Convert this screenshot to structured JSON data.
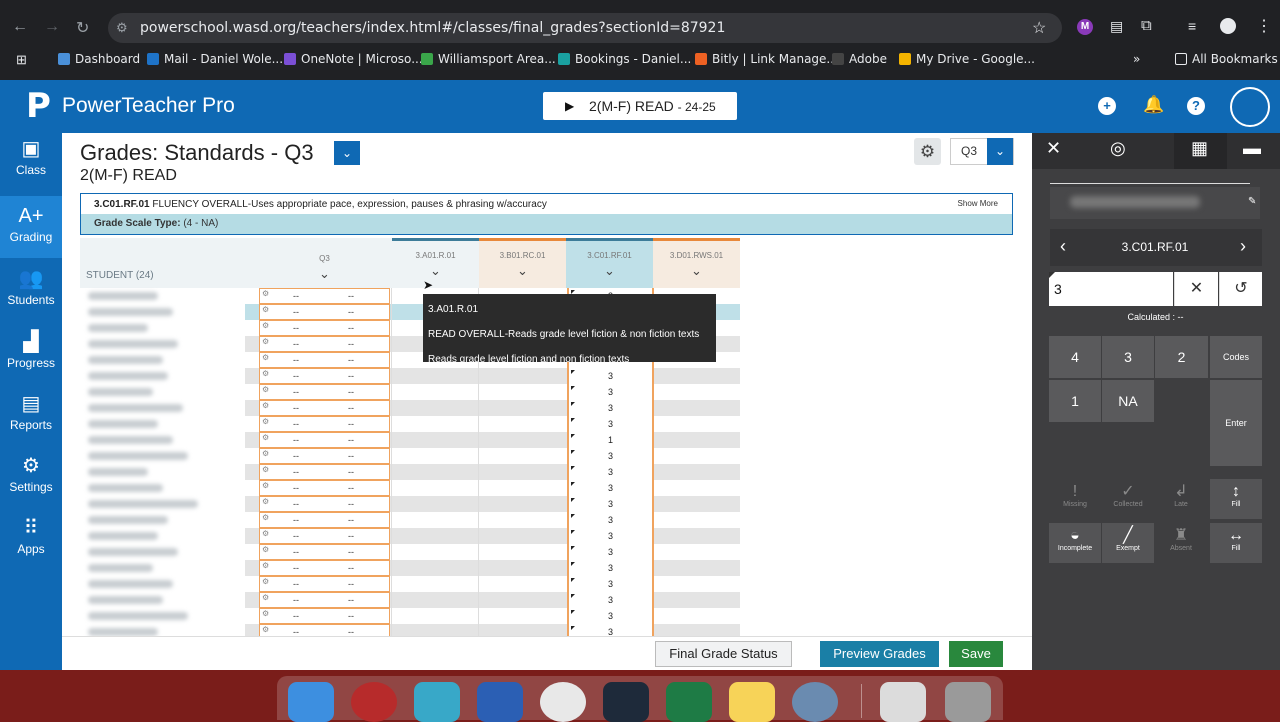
{
  "browser": {
    "url": "powerschool.wasd.org/teachers/index.html#/classes/final_grades?sectionId=87921",
    "bookmarks": [
      {
        "label": "Dashboard",
        "color": "#4a90d9"
      },
      {
        "label": "Mail - Daniel Wole...",
        "color": "#1e73c8"
      },
      {
        "label": "OneNote | Microso...",
        "color": "#7b4fd6"
      },
      {
        "label": "Williamsport Area...",
        "color": "#3aa64a"
      },
      {
        "label": "Bookings - Daniel...",
        "color": "#1aa1a1"
      },
      {
        "label": "Bitly | Link Manage...",
        "color": "#ee6123"
      },
      {
        "label": "Adobe",
        "color": "#111111"
      },
      {
        "label": "My Drive - Google...",
        "color": "#f4b400"
      }
    ],
    "all_bookmarks": "All Bookmarks",
    "profile_letter": "M"
  },
  "app": {
    "title": "PowerTeacher Pro",
    "class_selector": "2(M-F) READ",
    "class_year": "- 24-25"
  },
  "nav": [
    {
      "label": "Class",
      "icon": "class-icon",
      "glyph": "▣"
    },
    {
      "label": "Grading",
      "icon": "grading-icon",
      "glyph": "A+"
    },
    {
      "label": "Students",
      "icon": "students-icon",
      "glyph": "👥"
    },
    {
      "label": "Progress",
      "icon": "progress-icon",
      "glyph": "▟"
    },
    {
      "label": "Reports",
      "icon": "reports-icon",
      "glyph": "▤"
    },
    {
      "label": "Settings",
      "icon": "settings-icon",
      "glyph": "⚙"
    },
    {
      "label": "Apps",
      "icon": "apps-icon",
      "glyph": "⠿"
    }
  ],
  "page": {
    "title": "Grades: Standards - Q3",
    "subtitle": "2(M-F) READ",
    "term": "Q3",
    "standard_code": "3.C01.RF.01",
    "standard_desc": "FLUENCY OVERALL-Uses appropriate pace, expression, pauses & phrasing w/accuracy",
    "show_more": "Show More",
    "scale_label": "Grade Scale Type:",
    "scale_value": "(4 - NA)"
  },
  "grid": {
    "student_header": "STUDENT (24)",
    "columns": [
      {
        "label": "Q3",
        "accent": "#eef3f5",
        "top": "#eef3f5"
      },
      {
        "label": "3.A01.R.01",
        "accent": "#eef3f5",
        "top": "#3d7c99"
      },
      {
        "label": "3.B01.RC.01",
        "accent": "#f6ebe0",
        "top": "#e8883a"
      },
      {
        "label": "3.C01.RF.01",
        "accent": "#bfe0e8",
        "top": "#3d7c99"
      },
      {
        "label": "3.D01.RWS.01",
        "accent": "#f6ebe0",
        "top": "#e8883a"
      }
    ],
    "q3_placeholder": "--",
    "rf_scores": [
      "3",
      "",
      "",
      "",
      "",
      "3",
      "3",
      "3",
      "3",
      "1",
      "3",
      "3",
      "3",
      "3",
      "3",
      "3",
      "3",
      "3",
      "3",
      "3",
      "3",
      "3"
    ]
  },
  "tooltip": {
    "line1": "3.A01.R.01",
    "line2": "READ OVERALL-Reads grade level fiction & non fiction texts",
    "line3": "Reads grade level fiction and non fiction texts"
  },
  "footer": {
    "status": "Final Grade Status",
    "preview": "Preview Grades",
    "save": "Save"
  },
  "panel": {
    "standard": "3.C01.RF.01",
    "input_value": "3",
    "calculated": "Calculated : --",
    "keys": [
      "4",
      "3",
      "2",
      "Codes",
      "1",
      "NA",
      "Enter"
    ],
    "tools": [
      "Missing",
      "Collected",
      "Late",
      "Fill",
      "Incomplete",
      "Exempt",
      "Absent",
      "Fill"
    ]
  }
}
